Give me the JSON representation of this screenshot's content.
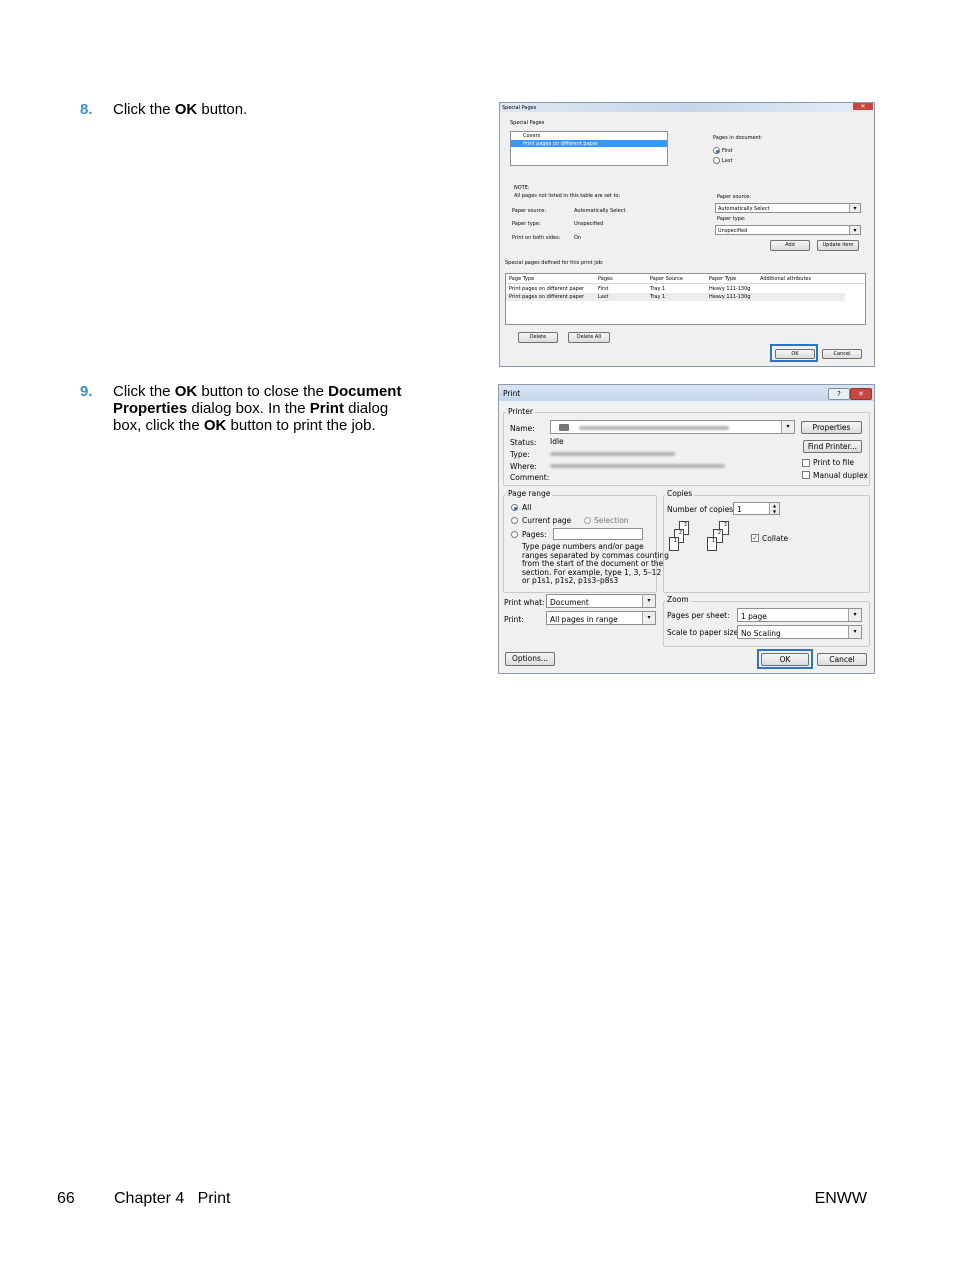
{
  "steps": [
    {
      "number": "8.",
      "pre": "Click the ",
      "b1": "OK",
      "post": " button."
    },
    {
      "number": "9.",
      "p1": "Click the ",
      "b1": "OK",
      "p2": " button to close the ",
      "b2": "Document",
      "b3": "Properties",
      "p3": " dialog box. In the ",
      "b4": "Print",
      "p4": " dialog",
      "p5": "box, click the ",
      "b5": "OK",
      "p6": " button to print the job."
    }
  ],
  "special_pages": {
    "title": "Special Pages",
    "subtitle": "Special Pages",
    "list_items": [
      "Covers",
      "Print pages on different paper"
    ],
    "pages_in_document_label": "Pages in document:",
    "radio_first": "First",
    "radio_last": "Last",
    "note_label": "NOTE:",
    "note_text": "All pages not listed in this table are set to:",
    "note_rows": [
      {
        "label": "Paper source:",
        "value": "Automatically Select"
      },
      {
        "label": "Paper type:",
        "value": "Unspecified"
      },
      {
        "label": "Print on both sides:",
        "value": "On"
      }
    ],
    "paper_source_label": "Paper source:",
    "paper_source_value": "Automatically Select",
    "paper_type_label": "Paper type:",
    "paper_type_value": "Unspecified",
    "add_label": "Add",
    "update_label": "Update item",
    "defined_label": "Special pages defined for this print job:",
    "table_headers": [
      "Page Type",
      "Pages",
      "Paper Source",
      "Paper Type",
      "Additional attributes"
    ],
    "table_rows": [
      [
        "Print pages on different paper",
        "First",
        "Tray 1",
        "Heavy 111-130g",
        ""
      ],
      [
        "Print pages on different paper",
        "Last",
        "Tray 1",
        "Heavy 111-130g",
        ""
      ]
    ],
    "delete_label": "Delete",
    "delete_all_label": "Delete All",
    "ok_label": "OK",
    "cancel_label": "Cancel"
  },
  "print_dialog": {
    "title": "Print",
    "help_glyph": "?",
    "close_glyph": "✕",
    "printer_group": "Printer",
    "name_label": "Name:",
    "status_label": "Status:",
    "status_value": "Idle",
    "type_label": "Type:",
    "where_label": "Where:",
    "comment_label": "Comment:",
    "properties_label": "Properties",
    "find_printer_label": "Find Printer...",
    "print_to_file_label": "Print to file",
    "manual_duplex_label": "Manual duplex",
    "page_range_group": "Page range",
    "all_label": "All",
    "current_page_label": "Current page",
    "selection_label": "Selection",
    "pages_label": "Pages:",
    "pages_help": [
      "Type page numbers and/or page",
      "ranges separated by commas counting",
      "from the start of the document or the",
      "section. For example, type 1, 3, 5–12",
      "or p1s1, p1s2, p1s3–p8s3"
    ],
    "copies_group": "Copies",
    "number_of_copies_label": "Number of copies:",
    "number_of_copies_value": "1",
    "collate_label": "Collate",
    "print_what_label": "Print what:",
    "print_what_value": "Document",
    "print_label": "Print:",
    "print_value": "All pages in range",
    "zoom_group": "Zoom",
    "pages_per_sheet_label": "Pages per sheet:",
    "pages_per_sheet_value": "1 page",
    "scale_label": "Scale to paper size:",
    "scale_value": "No Scaling",
    "options_label": "Options...",
    "ok_label": "OK",
    "cancel_label": "Cancel"
  },
  "footer": {
    "page_number": "66",
    "chapter": "Chapter 4   Print",
    "right": "ENWW"
  },
  "colors": {
    "step_number": "#3b8fd6",
    "selection": "#3399ff",
    "ok_border": "#2f74c0"
  }
}
